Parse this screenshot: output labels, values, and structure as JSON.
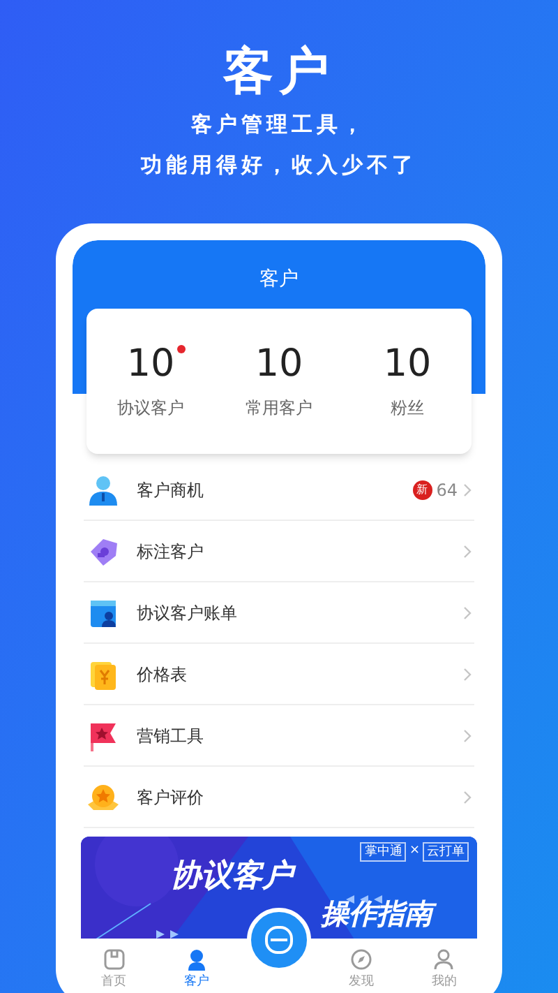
{
  "headline": "客户",
  "taglines": [
    "客户管理工具，",
    "功能用得好，收入少不了"
  ],
  "screen": {
    "title": "客户",
    "stats": [
      {
        "value": "10",
        "label": "协议客户",
        "dot": true
      },
      {
        "value": "10",
        "label": "常用客户",
        "dot": false
      },
      {
        "value": "10",
        "label": "粉丝",
        "dot": false
      }
    ],
    "menu": [
      {
        "kind": "person",
        "label": "客户商机",
        "badge": "新",
        "count": "64"
      },
      {
        "kind": "tag",
        "label": "标注客户"
      },
      {
        "kind": "bill",
        "label": "协议客户账单"
      },
      {
        "kind": "price",
        "label": "价格表"
      },
      {
        "kind": "flag",
        "label": "营销工具"
      },
      {
        "kind": "medal",
        "label": "客户评价"
      }
    ],
    "banner": {
      "title": "协议客户",
      "subtitle": "操作指南",
      "brand_a": "掌中通",
      "times": "×",
      "brand_b": "云打单"
    },
    "nav": [
      {
        "kind": "home",
        "label": "首页",
        "selected": false
      },
      {
        "kind": "user",
        "label": "客户",
        "selected": true
      },
      {
        "kind": "scan"
      },
      {
        "kind": "compass",
        "label": "发现",
        "selected": false
      },
      {
        "kind": "me",
        "label": "我的",
        "selected": false
      }
    ]
  }
}
